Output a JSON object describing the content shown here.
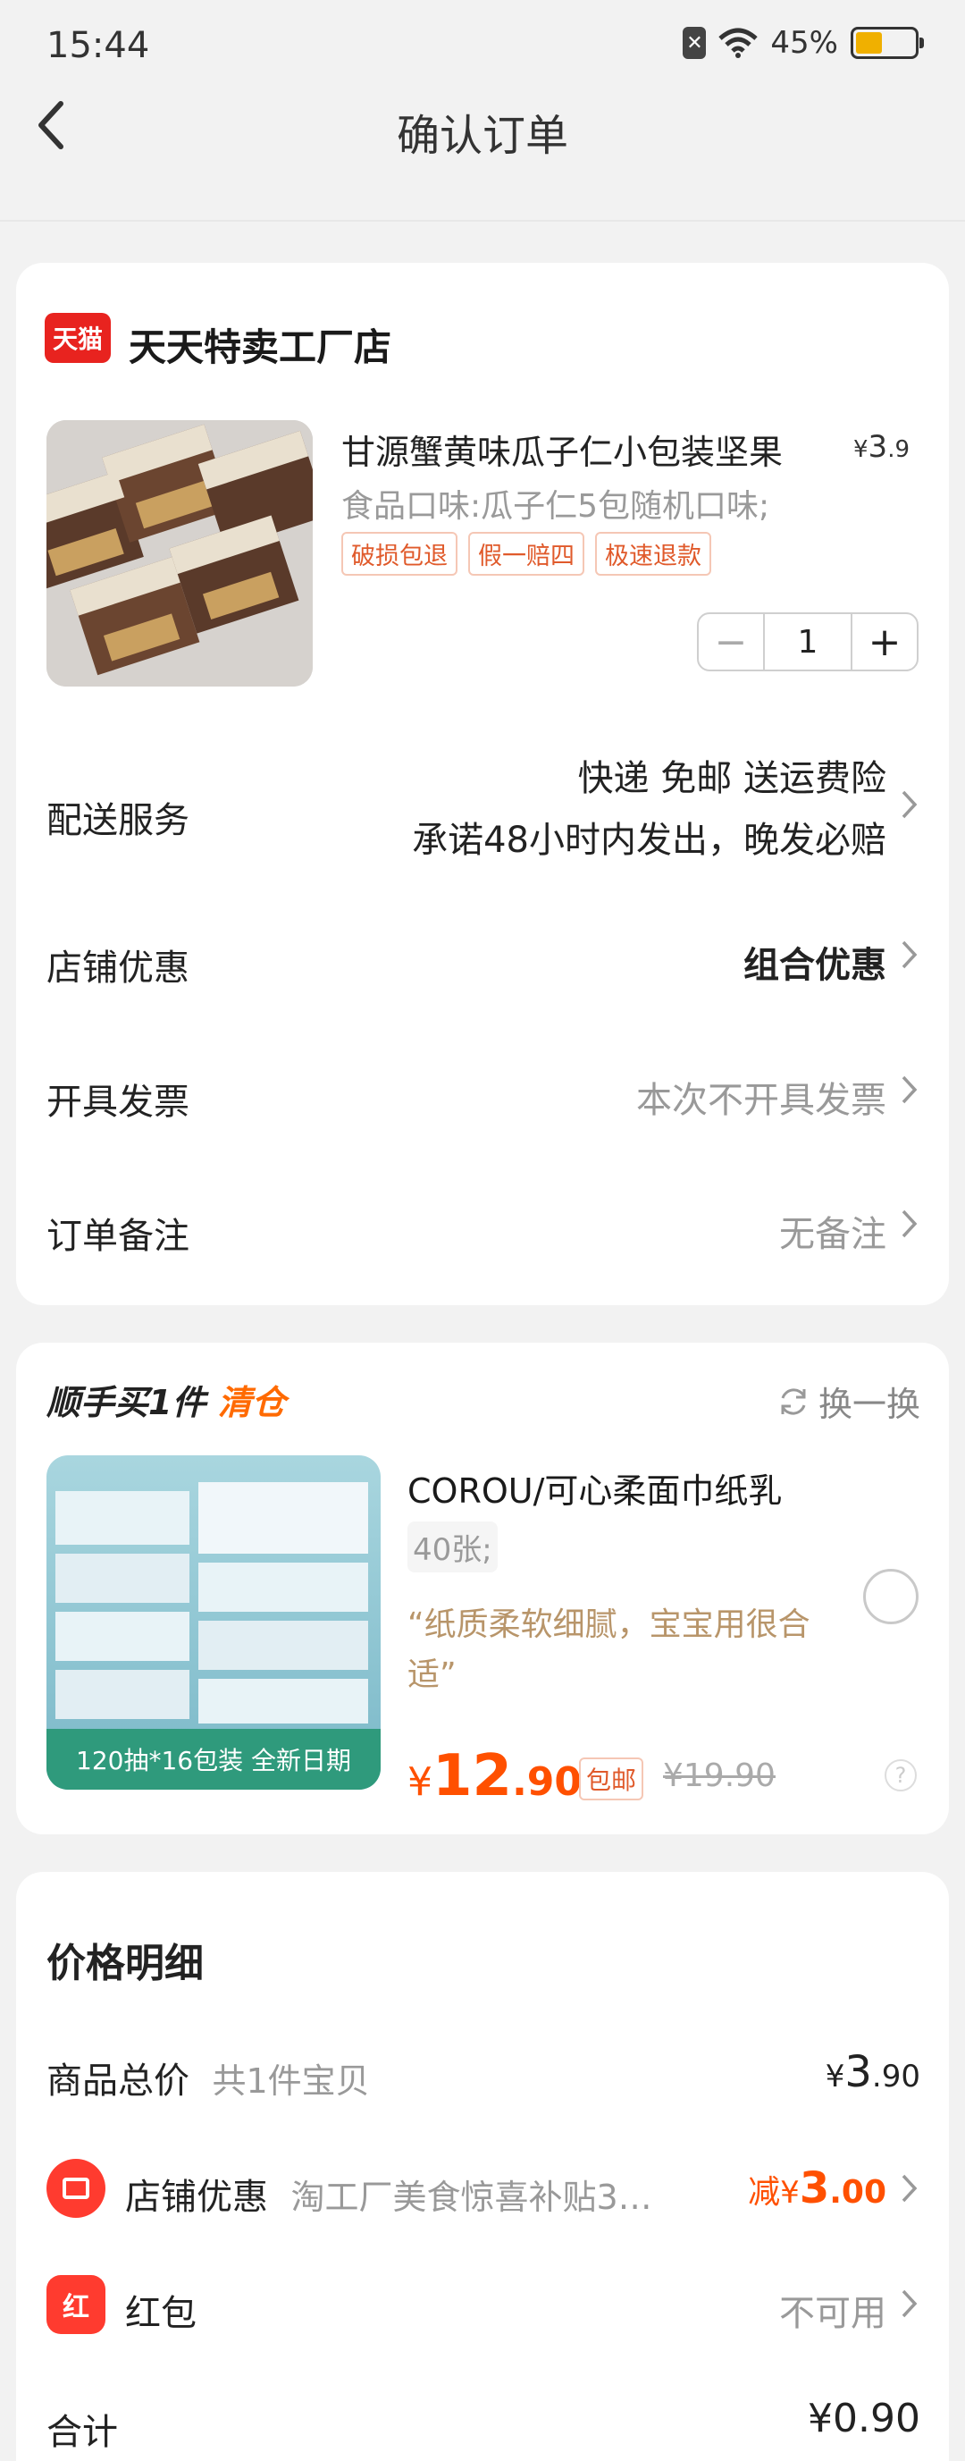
{
  "status_bar": {
    "time": "15:44",
    "battery": "45%",
    "battery_level": 0.45
  },
  "nav": {
    "title": "确认订单"
  },
  "store": {
    "logo_text": "天猫",
    "name": "天天特卖工厂店",
    "product": {
      "title": "甘源蟹黄味瓜子仁小包装坚果",
      "price_currency": "¥",
      "price_int": "3",
      "price_dec": ".9",
      "spec": "食品口味:瓜子仁5包随机口味;",
      "tags": [
        "破损包退",
        "假一赔四",
        "极速退款"
      ],
      "quantity": "1"
    },
    "rows": {
      "shipping_label": "配送服务",
      "shipping_line1": "快递 免邮 送运费险",
      "shipping_line2": "承诺48小时内发出，晚发必赔",
      "discount_label": "店铺优惠",
      "discount_value": "组合优惠",
      "invoice_label": "开具发票",
      "invoice_value": "本次不开具发票",
      "note_label": "订单备注",
      "note_value": "无备注"
    }
  },
  "addon": {
    "title": "顺手买1件",
    "title_tag": "清仓",
    "swap_label": "换一换",
    "product": {
      "title": "COROU/可心柔面巾纸乳",
      "spec": "40张;",
      "quote": "“纸质柔软细腻，宝宝用很合适”",
      "image_banner": "120抽*16包装 全新日期",
      "price_currency": "¥",
      "price_int": "12",
      "price_dec": ".90",
      "free_shipping": "包邮",
      "original_price": "¥19.90",
      "help": "?"
    }
  },
  "price_detail": {
    "title": "价格明细",
    "goods_total_label": "商品总价",
    "goods_total_sub": "共1件宝贝",
    "goods_total_currency": "¥",
    "goods_total_int": "3",
    "goods_total_dec": ".90",
    "store_discount_label": "店铺优惠",
    "store_discount_sub": "淘工厂美食惊喜补贴3…",
    "store_discount_prefix": "减",
    "store_discount_currency": "¥",
    "store_discount_int": "3",
    "store_discount_dec": ".00",
    "red_packet_icon": "红",
    "red_packet_label": "红包",
    "red_packet_value": "不可用",
    "total_label": "合计",
    "total_value": "¥0.90"
  },
  "colors": {
    "accent": "#ff5000",
    "tmall_red": "#e8231f",
    "background": "#f2f2f2"
  }
}
